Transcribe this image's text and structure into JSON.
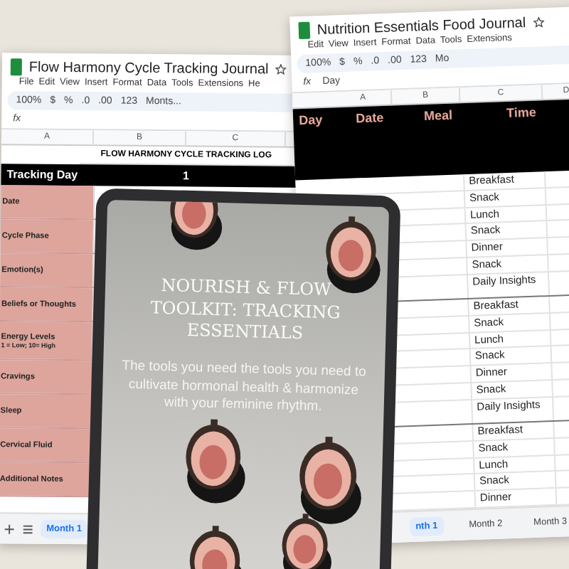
{
  "left_sheet": {
    "title": "Flow Harmony Cycle Tracking Journal",
    "menu": [
      "File",
      "Edit",
      "View",
      "Insert",
      "Format",
      "Data",
      "Tools",
      "Extensions",
      "He"
    ],
    "toolbar": {
      "zoom": "100%",
      "buttons": [
        "$",
        "%",
        ".0",
        ".00",
        "123"
      ],
      "font": "Monts..."
    },
    "fx": "fx",
    "columns": [
      "A",
      "B",
      "C"
    ],
    "heading": "FLOW HARMONY CYCLE TRACKING LOG",
    "header_row": {
      "label": "Tracking Day",
      "days": [
        "1"
      ]
    },
    "rows": [
      {
        "label": "Date"
      },
      {
        "label": "Cycle Phase"
      },
      {
        "label": "Emotion(s)"
      },
      {
        "label": "Beliefs or Thoughts"
      },
      {
        "label": "Energy Levels",
        "note": "1 = Low; 10= High"
      },
      {
        "label": "Cravings"
      },
      {
        "label": "Sleep"
      },
      {
        "label": "Cervical Fluid"
      },
      {
        "label": "Additional Notes"
      }
    ],
    "sheet_tabs": [
      {
        "label": "Month 1",
        "selected": true
      }
    ]
  },
  "right_sheet": {
    "title": "Nutrition Essentials Food Journal",
    "menu": [
      "Edit",
      "View",
      "Insert",
      "Format",
      "Data",
      "Tools",
      "Extensions"
    ],
    "toolbar": {
      "zoom": "100%",
      "buttons": [
        "$",
        "%",
        ".0",
        ".00",
        "123"
      ],
      "font": "Mo"
    },
    "fx": "fx",
    "formula": "Day",
    "columns": [
      "A",
      "B",
      "C",
      "D"
    ],
    "header": [
      "Day",
      "Date",
      "Meal",
      "Time"
    ],
    "meals": [
      "Breakfast",
      "Snack",
      "Lunch",
      "Snack",
      "Dinner",
      "Snack",
      "Daily Insights",
      "Breakfast",
      "Snack",
      "Lunch",
      "Snack",
      "Dinner",
      "Snack",
      "Daily Insights",
      "Breakfast",
      "Snack",
      "Lunch",
      "Snack",
      "Dinner"
    ],
    "sheet_tabs": [
      {
        "label": "nth 1",
        "selected": true
      },
      {
        "label": "Month 2",
        "selected": false
      },
      {
        "label": "Month 3",
        "selected": false
      }
    ]
  },
  "tablet": {
    "title": "NOURISH & FLOW TOOLKIT: TRACKING ESSENTIALS",
    "subtitle": "The tools you need the tools you need to cultivate hormonal health & harmonize with your feminine rhythm."
  }
}
